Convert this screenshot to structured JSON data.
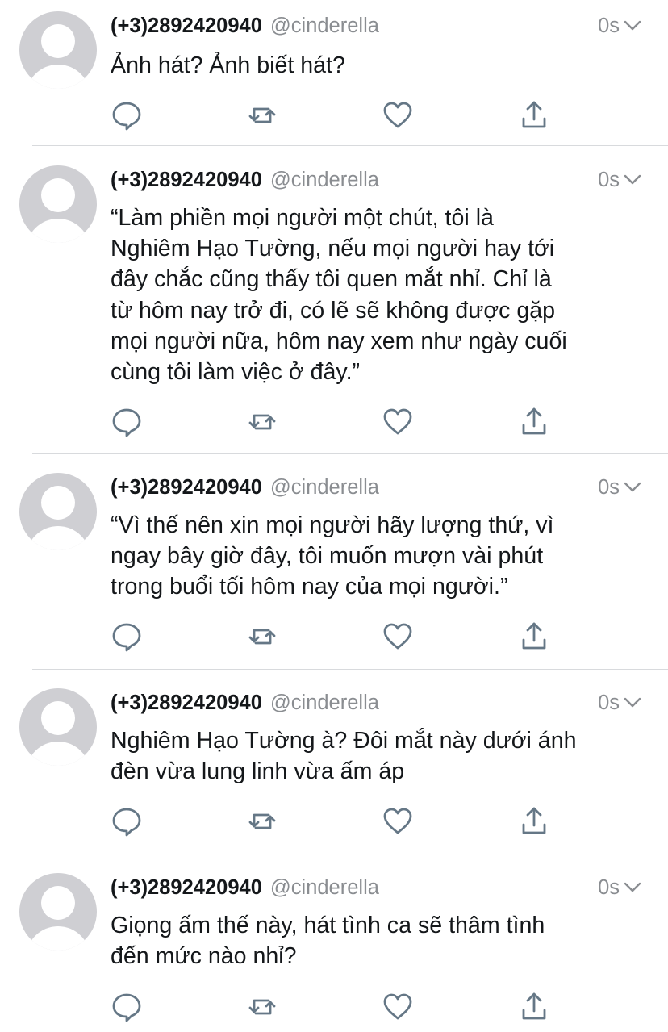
{
  "tweets": [
    {
      "name": "(+3)2892420940",
      "handle": "@cinderella",
      "time": "0s",
      "text": "Ảnh hát? Ảnh biết hát?"
    },
    {
      "name": "(+3)2892420940",
      "handle": "@cinderella",
      "time": "0s",
      "text": "“Làm phiền mọi người một chút, tôi là\nNghiêm Hạo Tường, nếu mọi người hay tới\nđây chắc cũng thấy tôi quen mắt nhỉ. Chỉ là\ntừ hôm nay trở đi, có lẽ sẽ không được gặp\nmọi người nữa, hôm nay xem như ngày cuối\ncùng tôi làm việc ở đây.”"
    },
    {
      "name": "(+3)2892420940",
      "handle": "@cinderella",
      "time": "0s",
      "text": "“Vì thế nên xin mọi người hãy lượng thứ, vì\nngay bây giờ đây, tôi muốn mượn vài phút\ntrong buổi tối hôm nay của mọi người.”"
    },
    {
      "name": "(+3)2892420940",
      "handle": "@cinderella",
      "time": "0s",
      "text": "Nghiêm Hạo Tường à? Đôi mắt này dưới ánh\nđèn vừa lung linh vừa ấm áp"
    },
    {
      "name": "(+3)2892420940",
      "handle": "@cinderella",
      "time": "0s",
      "text": "Giọng ấm thế này, hát tình ca sẽ thâm tình\nđến mức nào nhỉ?"
    }
  ],
  "icons": {
    "reply": "reply-icon",
    "retweet": "retweet-icon",
    "like": "heart-icon",
    "share": "share-icon",
    "menu": "chevron-down-icon"
  },
  "colors": {
    "icon": "#657786",
    "secondary_text": "#8a8d91",
    "avatar_bg": "#cfcfd3",
    "divider": "#d8dadd"
  }
}
